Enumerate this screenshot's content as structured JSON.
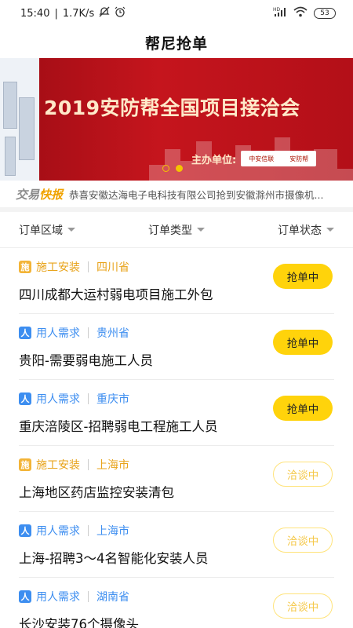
{
  "status_bar": {
    "time": "15:40",
    "network_speed": "1.7K/s",
    "battery": "53",
    "icons": [
      "mute-icon",
      "alarm-icon",
      "hd-signal-icon",
      "signal-icon",
      "wifi-icon",
      "battery-icon"
    ]
  },
  "header": {
    "title": "帮尼抢单"
  },
  "banner": {
    "title": "2019安防帮全国项目接洽会",
    "host_label": "主办单位:",
    "host_logos": [
      "中安信联",
      "安防帮"
    ],
    "page_count": 2,
    "active_page": 1
  },
  "ticker": {
    "brand_part1": "交易",
    "brand_part2": "快报",
    "text": "恭喜安徽达海电子电科技有限公司抢到安徽滁州市摄像机..."
  },
  "filters": [
    {
      "label": "订单区域"
    },
    {
      "label": "订单类型"
    },
    {
      "label": "订单状态"
    }
  ],
  "orders": [
    {
      "icon_text": "施",
      "type": "施工安装",
      "kind": "shigong",
      "region": "四川省",
      "title": "四川成都大运村弱电项目施工外包",
      "status": "抢单中",
      "status_kind": "active"
    },
    {
      "icon_text": "人",
      "type": "用人需求",
      "kind": "yongren",
      "region": "贵州省",
      "title": "贵阳-需要弱电施工人员",
      "status": "抢单中",
      "status_kind": "active"
    },
    {
      "icon_text": "人",
      "type": "用人需求",
      "kind": "yongren",
      "region": "重庆市",
      "title": "重庆涪陵区-招聘弱电工程施工人员",
      "status": "抢单中",
      "status_kind": "active"
    },
    {
      "icon_text": "施",
      "type": "施工安装",
      "kind": "shigong",
      "region": "上海市",
      "title": "上海地区药店监控安装清包",
      "status": "洽谈中",
      "status_kind": "negotiating"
    },
    {
      "icon_text": "人",
      "type": "用人需求",
      "kind": "yongren",
      "region": "上海市",
      "title": "上海-招聘3～4名智能化安装人员",
      "status": "洽谈中",
      "status_kind": "negotiating"
    },
    {
      "icon_text": "人",
      "type": "用人需求",
      "kind": "yongren",
      "region": "湖南省",
      "title": "长沙安装76个摄像头",
      "status": "洽谈中",
      "status_kind": "negotiating"
    }
  ],
  "colors": {
    "accent_yellow": "#ffd30b",
    "shigong_orange": "#f3b437",
    "yongren_blue": "#3d8ef0",
    "banner_red": "#c5151d"
  }
}
